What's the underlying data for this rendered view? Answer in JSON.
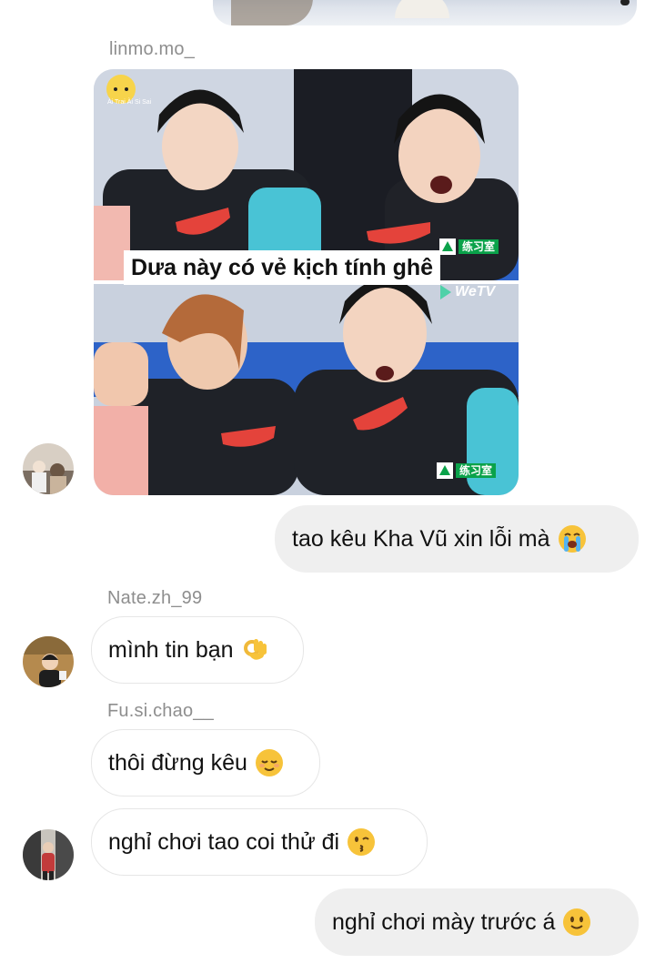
{
  "thread": {
    "messages": [
      {
        "sender": "linmo.mo_",
        "type": "image",
        "image": {
          "caption": "Dưa này có vẻ kịch tính ghê",
          "watermark": "WeTV",
          "badge": "练习室",
          "corner_label": "Ài Trai Ài Si Sai"
        }
      },
      {
        "direction": "outgoing",
        "text": "tao kêu Kha Vũ xin lỗi mà",
        "emoji": "loudly-crying-face-icon"
      },
      {
        "sender": "Nate.zh_99",
        "text": "mình tin bạn",
        "emoji": "ok-hand-icon"
      },
      {
        "sender": "Fu.si.chao__",
        "text": "thôi đừng kêu",
        "emoji": "relieved-face-icon"
      },
      {
        "text": "nghỉ chơi tao coi thử đi",
        "emoji": "kissing-face-icon"
      },
      {
        "direction": "outgoing",
        "text": "nghỉ chơi mày trước á",
        "emoji": "slightly-smiling-face-icon"
      }
    ]
  },
  "colors": {
    "outgoing_bubble": "#efefef",
    "incoming_border": "#e6e6e6",
    "sender_name": "#8e8e8e",
    "emoji_yellow": "#f7c33a"
  }
}
